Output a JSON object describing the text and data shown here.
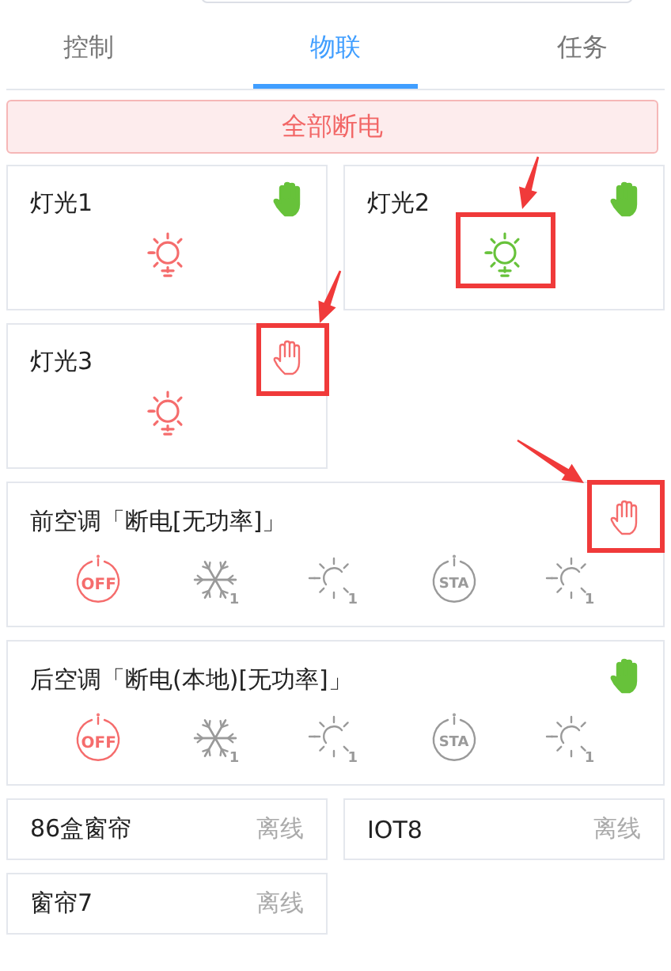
{
  "tabs": [
    {
      "label": "控制",
      "selected": false
    },
    {
      "label": "物联",
      "selected": true
    },
    {
      "label": "任务",
      "selected": false
    }
  ],
  "power_off_all": {
    "label": "全部断电"
  },
  "lights": [
    {
      "name": "灯光1",
      "on": false,
      "manual": true,
      "bulb_highlighted": false,
      "hand_highlighted": false
    },
    {
      "name": "灯光2",
      "on": true,
      "manual": true,
      "bulb_highlighted": true,
      "hand_highlighted": false
    },
    {
      "name": "灯光3",
      "on": false,
      "manual": false,
      "bulb_highlighted": false,
      "hand_highlighted": true
    }
  ],
  "air_conditioners": [
    {
      "name": "前空调「断电[无功率]」",
      "manual": false,
      "hand_highlighted": true,
      "modes": [
        {
          "kind": "power",
          "label": "OFF",
          "selected": true
        },
        {
          "kind": "cool",
          "label": "1",
          "selected": false
        },
        {
          "kind": "heat",
          "label": "1",
          "selected": false
        },
        {
          "kind": "status",
          "label": "STA",
          "selected": false
        },
        {
          "kind": "heat",
          "label": "1",
          "selected": false
        }
      ]
    },
    {
      "name": "后空调「断电(本地)[无功率]」",
      "manual": true,
      "hand_highlighted": false,
      "modes": [
        {
          "kind": "power",
          "label": "OFF",
          "selected": true
        },
        {
          "kind": "cool",
          "label": "1",
          "selected": false
        },
        {
          "kind": "heat",
          "label": "1",
          "selected": false
        },
        {
          "kind": "status",
          "label": "STA",
          "selected": false
        },
        {
          "kind": "heat",
          "label": "1",
          "selected": false
        }
      ]
    }
  ],
  "devices": [
    {
      "name": "86盒窗帘",
      "status": "离线"
    },
    {
      "name": "IOT8",
      "status": "离线"
    },
    {
      "name": "窗帘7",
      "status": "离线"
    }
  ]
}
